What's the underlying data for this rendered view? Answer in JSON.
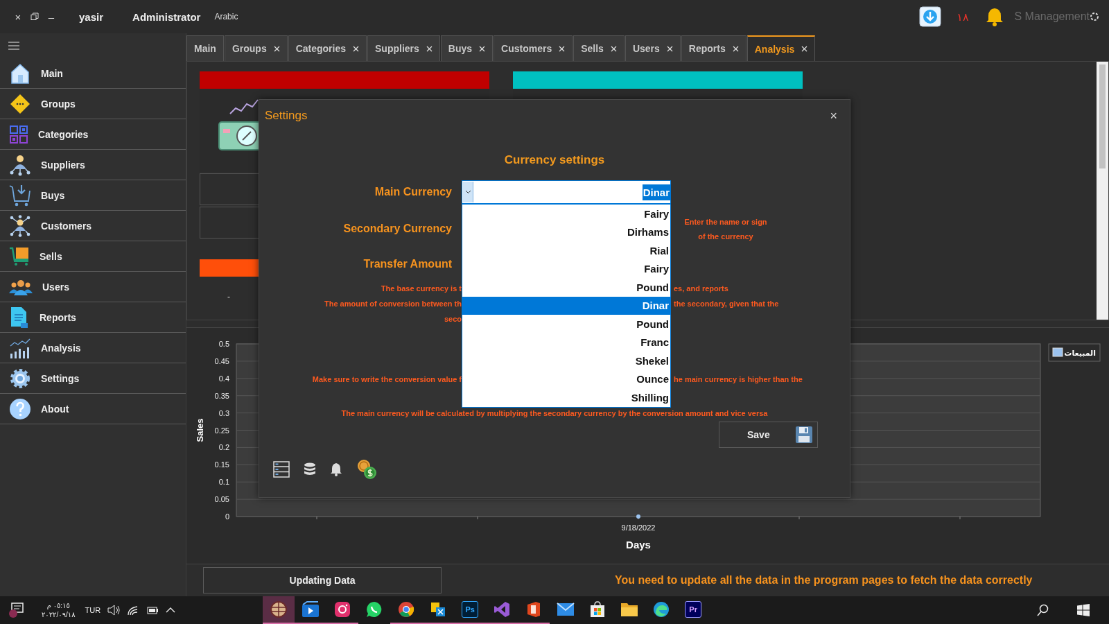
{
  "title_bar": {
    "window_controls": [
      "×",
      "–"
    ],
    "user": "yasir",
    "role": "Administrator",
    "language": "Arabic",
    "notification_count": "١٨",
    "app_name": "S Management"
  },
  "sidebar": {
    "items": [
      {
        "label": "Main",
        "selected": false
      },
      {
        "label": "Groups",
        "selected": false
      },
      {
        "label": "Categories",
        "selected": false
      },
      {
        "label": "Suppliers",
        "selected": false
      },
      {
        "label": "Buys",
        "selected": false
      },
      {
        "label": "Customers",
        "selected": false
      },
      {
        "label": "Sells",
        "selected": false
      },
      {
        "label": "Users",
        "selected": false
      },
      {
        "label": "Reports",
        "selected": false
      },
      {
        "label": "Analysis",
        "selected": false
      },
      {
        "label": "Settings",
        "selected": false
      },
      {
        "label": "About",
        "selected": false
      }
    ]
  },
  "tabs": [
    {
      "label": "Main",
      "selected": false,
      "closable": false
    },
    {
      "label": "Groups",
      "selected": false,
      "closable": true
    },
    {
      "label": "Categories",
      "selected": false,
      "closable": true
    },
    {
      "label": "Suppliers",
      "selected": false,
      "closable": true
    },
    {
      "label": "Buys",
      "selected": false,
      "closable": true
    },
    {
      "label": "Customers",
      "selected": false,
      "closable": true
    },
    {
      "label": "Sells",
      "selected": false,
      "closable": true
    },
    {
      "label": "Users",
      "selected": false,
      "closable": true
    },
    {
      "label": "Reports",
      "selected": false,
      "closable": true
    },
    {
      "label": "Analysis",
      "selected": true,
      "closable": true
    }
  ],
  "analysis_page": {
    "card_value": "-"
  },
  "chart": {
    "chart_data": {
      "type": "line",
      "xlabel": "Days",
      "ylabel": "Sales",
      "categories": [
        "9/18/2022"
      ],
      "grid": true,
      "ylim": [
        0,
        0.5
      ],
      "yticks": [
        0,
        0.05,
        0.1,
        0.15,
        0.2,
        0.25,
        0.3,
        0.35,
        0.4,
        0.45,
        0.5
      ],
      "series": [
        {
          "name": "المبيعات",
          "color": "#9cc3ef",
          "marker": "circle",
          "values": [
            0
          ]
        }
      ]
    }
  },
  "settings_dialog": {
    "title": "Settings",
    "close": "×",
    "heading": "Currency settings",
    "main_currency": {
      "label": "Main Currency",
      "value": "Dinar",
      "expanded": true,
      "options": [
        {
          "label": "Fairy",
          "selected": false
        },
        {
          "label": "Dirhams",
          "selected": false
        },
        {
          "label": "Rial",
          "selected": false
        },
        {
          "label": "Fairy",
          "selected": false
        },
        {
          "label": "Pound",
          "selected": false
        },
        {
          "label": "Dinar",
          "selected": true
        },
        {
          "label": "Pound",
          "selected": false
        },
        {
          "label": "Franc",
          "selected": false
        },
        {
          "label": "Shekel",
          "selected": false
        },
        {
          "label": "Ounce",
          "selected": false
        },
        {
          "label": "Shilling",
          "selected": false
        }
      ]
    },
    "secondary_currency": {
      "label": "Secondary Currency"
    },
    "hint": [
      "Enter the name or sign",
      "of the currency"
    ],
    "transfer_amount": {
      "label": "Transfer Amount"
    },
    "notes": [
      {
        "left": "The base currency is t",
        "right": "es, and reports"
      },
      {
        "left": "The amount of conversion between th",
        "right": "the secondary, given that the"
      },
      {
        "left": "seco"
      },
      {
        "left": "Make sure to write the conversion value f",
        "right": "he main currency is higher than the"
      }
    ],
    "footer_note": "The main currency will be calculated by multiplying the secondary currency by the conversion amount and vice versa",
    "save": "Save"
  },
  "bottom_bar": {
    "button": "Updating Data",
    "message": "You need to update all the data in the program pages to fetch the data correctly"
  },
  "taskbar": {
    "time": "٠٥:١٥ م",
    "date": "٢٠٢٢/٠٩/١٨",
    "keyboard": "TUR",
    "apps": [
      {
        "selected": true,
        "running": true
      },
      {
        "selected": false,
        "running": true
      },
      {
        "selected": false,
        "running": true
      },
      {
        "selected": false,
        "running": false
      },
      {
        "selected": false,
        "running": true
      },
      {
        "selected": false,
        "running": true
      },
      {
        "selected": false,
        "running": true,
        "label": "Ps"
      },
      {
        "selected": false,
        "running": true
      },
      {
        "selected": false,
        "running": true
      },
      {
        "selected": false,
        "running": false
      },
      {
        "selected": false,
        "running": false
      },
      {
        "selected": false,
        "running": false
      },
      {
        "selected": false,
        "running": false
      },
      {
        "selected": false,
        "running": false,
        "label": "Pr"
      }
    ]
  }
}
